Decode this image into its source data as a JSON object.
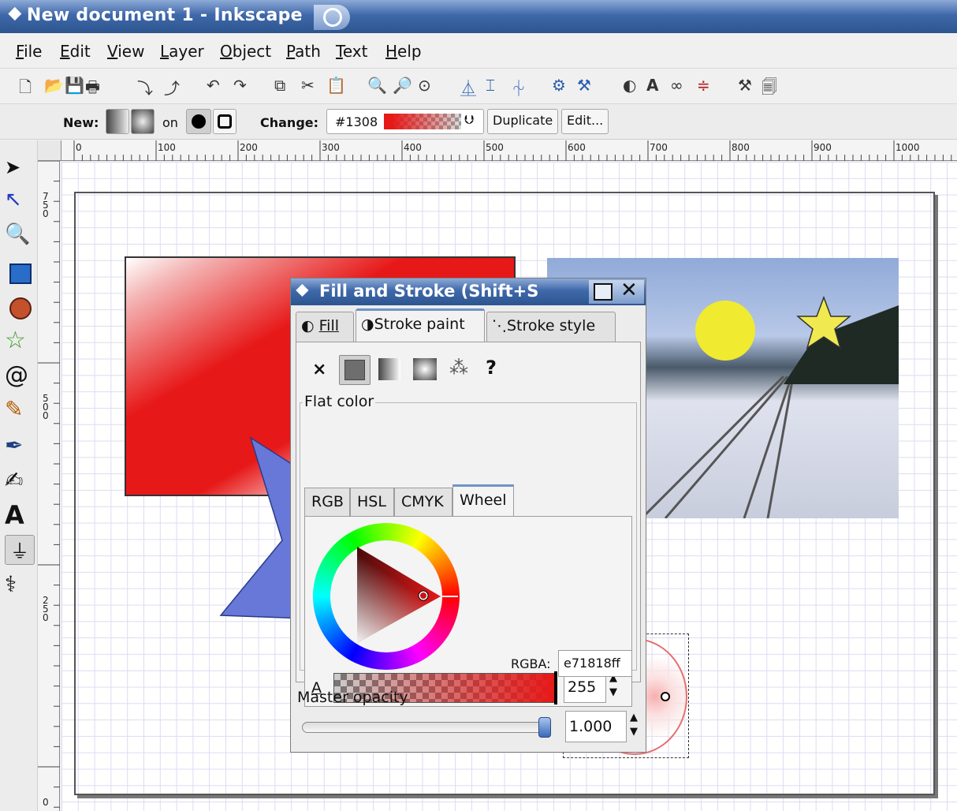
{
  "window": {
    "title": "New document 1 - Inkscape"
  },
  "menu": [
    "File",
    "Edit",
    "View",
    "Layer",
    "Object",
    "Path",
    "Text",
    "Help"
  ],
  "toolbar_icons": [
    "new-doc",
    "open",
    "save",
    "print",
    "import",
    "export",
    "undo",
    "redo",
    "duplicate",
    "cut",
    "paste",
    "zoom-selection",
    "zoom-drawing",
    "zoom-page",
    "align-1",
    "align-2",
    "align-3",
    "node-1",
    "node-2",
    "fill-stroke",
    "text-font",
    "xml-editor",
    "align-distribute",
    "preferences",
    "document-props"
  ],
  "controls": {
    "new_label": "New:",
    "on_label": "on",
    "change_label": "Change:",
    "gradient_name": "#1308",
    "duplicate_label": "Duplicate",
    "edit_label": "Edit..."
  },
  "ruler": {
    "h_labels": [
      "0",
      "100",
      "200",
      "300",
      "400",
      "500",
      "600",
      "700",
      "800",
      "900",
      "1000"
    ],
    "v_labels": [
      "750",
      "500",
      "250",
      "0"
    ]
  },
  "tools": [
    "selector",
    "node",
    "zoom",
    "rectangle",
    "ellipse",
    "star",
    "spiral",
    "pencil",
    "pen",
    "calligraphy",
    "text",
    "gradient",
    "dropper"
  ],
  "dialog": {
    "title": "Fill and Stroke (Shift+S",
    "tabs": [
      "Fill",
      "Stroke paint",
      "Stroke style"
    ],
    "active_tab": "Stroke paint",
    "paint_none": "×",
    "paint_unknown": "?",
    "flat_color_label": "Flat color",
    "color_tabs": [
      "RGB",
      "HSL",
      "CMYK",
      "Wheel"
    ],
    "active_color_tab": "Wheel",
    "alpha_label": "A",
    "alpha_value": "255",
    "rgba_label": "RGBA:",
    "rgba_value": "e71818ff",
    "master_opacity_label": "Master opacity",
    "master_opacity_value": "1.000",
    "master_opacity_fraction": 1.0
  },
  "colors": {
    "accent": "#e71818",
    "title_blue": "#3f68aa"
  }
}
